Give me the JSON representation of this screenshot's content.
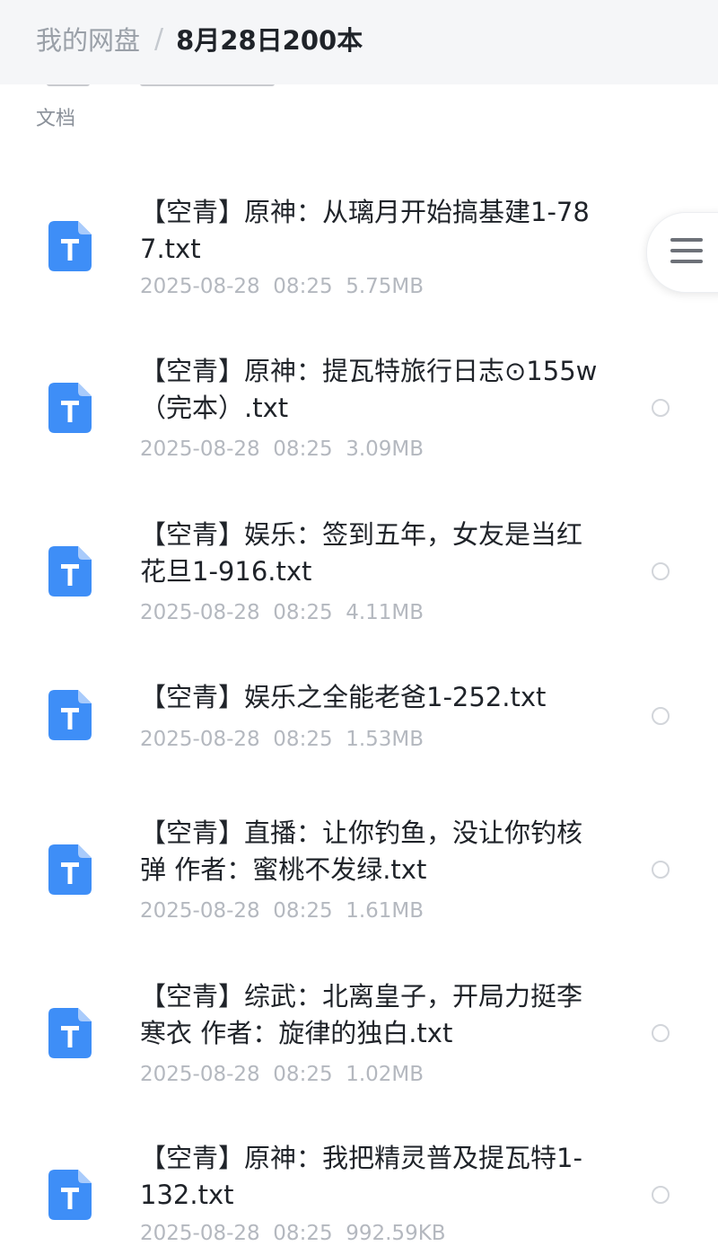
{
  "header": {
    "root_label": "我的网盘",
    "separator": "/",
    "current_folder": "8月28日200本"
  },
  "section": {
    "label": "文档"
  },
  "colors": {
    "icon_blue": "#3e8ef7",
    "header_bg": "#f5f6f8"
  },
  "files": [
    {
      "name": "【空青】原神：从璃月开始搞基建1-787.txt",
      "date": "2025-08-28",
      "time": "08:25",
      "size": "5.75MB",
      "icon": "txt-file-icon"
    },
    {
      "name": "【空青】原神：提瓦特旅行日志⊙155w（完本）.txt",
      "date": "2025-08-28",
      "time": "08:25",
      "size": "3.09MB",
      "icon": "txt-file-icon"
    },
    {
      "name": "【空青】娱乐：签到五年，女友是当红花旦1-916.txt",
      "date": "2025-08-28",
      "time": "08:25",
      "size": "4.11MB",
      "icon": "txt-file-icon"
    },
    {
      "name": "【空青】娱乐之全能老爸1-252.txt",
      "date": "2025-08-28",
      "time": "08:25",
      "size": "1.53MB",
      "icon": "txt-file-icon"
    },
    {
      "name": "【空青】直播：让你钓鱼，没让你钓核弹 作者：蜜桃不发绿.txt",
      "date": "2025-08-28",
      "time": "08:25",
      "size": "1.61MB",
      "icon": "txt-file-icon"
    },
    {
      "name": "【空青】综武：北离皇子，开局力挺李寒衣 作者：旋律的独白.txt",
      "date": "2025-08-28",
      "time": "08:25",
      "size": "1.02MB",
      "icon": "txt-file-icon"
    },
    {
      "name": "【空青】原神：我把精灵普及提瓦特1-132.txt",
      "date": "2025-08-28",
      "time": "08:25",
      "size": "992.59KB",
      "icon": "txt-file-icon"
    }
  ],
  "float_menu": {
    "icon": "menu-icon"
  }
}
